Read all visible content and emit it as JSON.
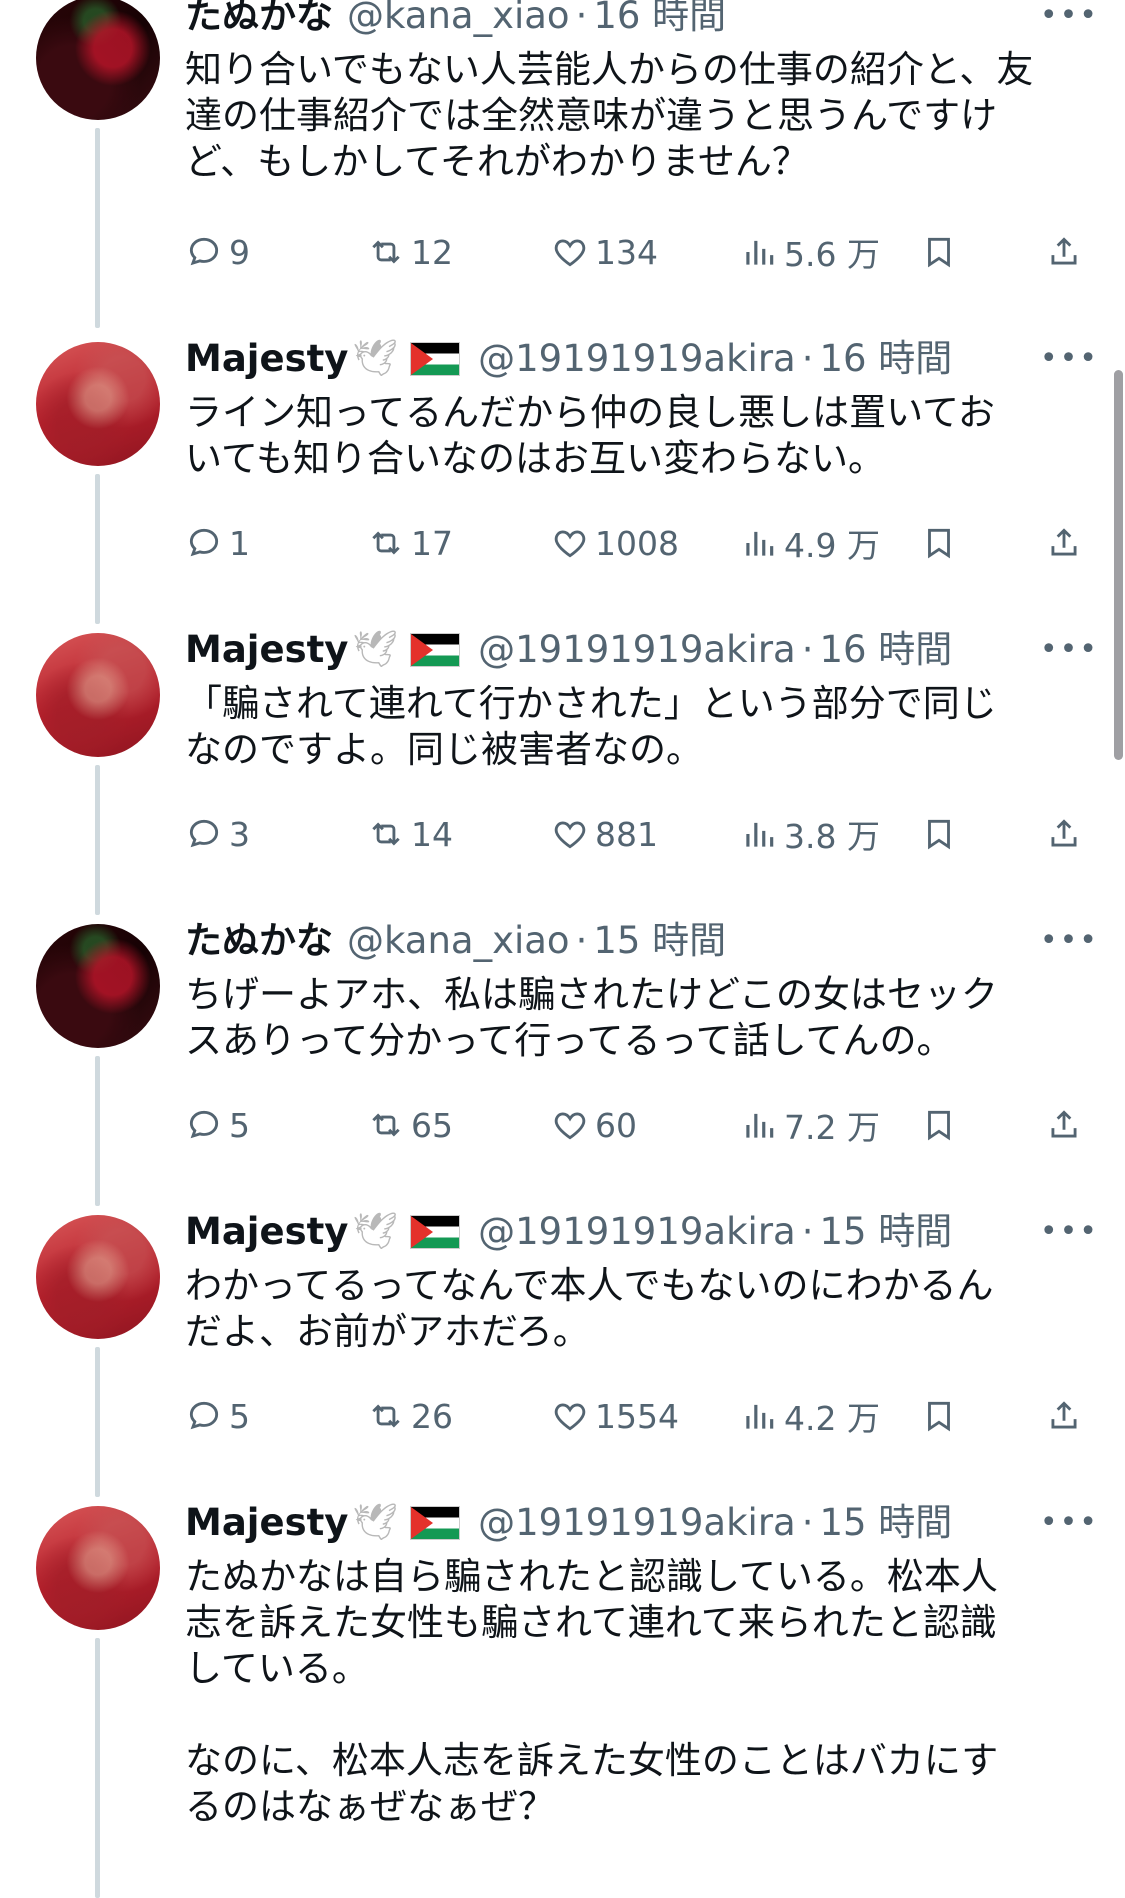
{
  "tweets": [
    {
      "author": "たぬかな",
      "avatar": "kana-avatar",
      "verified_emoji": "",
      "flag": "",
      "handle": "@kana_xiao",
      "time": "16 時間",
      "text": "知り合いでもない人芸能人からの仕事の紹介と、友\n達の仕事紹介では全然意味が違うと思うんですけ\nど、もしかしてそれがわかりません？",
      "replies": "9",
      "retweets": "12",
      "likes": "134",
      "views": "5.6 万"
    },
    {
      "author": "Majesty",
      "avatar": "majesty-avatar",
      "verified_emoji": "🕊",
      "flag": "palestine-flag",
      "handle": "@19191919akira",
      "time": "16 時間",
      "text": "ライン知ってるんだから仲の良し悪しは置いてお\nいても知り合いなのはお互い変わらない。",
      "replies": "1",
      "retweets": "17",
      "likes": "1008",
      "views": "4.9 万"
    },
    {
      "author": "Majesty",
      "avatar": "majesty-avatar",
      "verified_emoji": "🕊",
      "flag": "palestine-flag",
      "handle": "@19191919akira",
      "time": "16 時間",
      "text": "「騙されて連れて行かされた」という部分で同じ\nなのですよ。同じ被害者なの。",
      "replies": "3",
      "retweets": "14",
      "likes": "881",
      "views": "3.8 万"
    },
    {
      "author": "たぬかな",
      "avatar": "kana-avatar",
      "verified_emoji": "",
      "flag": "",
      "handle": "@kana_xiao",
      "time": "15 時間",
      "text": "ちげーよアホ、私は騙されたけどこの女はセック\nスありって分かって行ってるって話してんの。",
      "replies": "5",
      "retweets": "65",
      "likes": "60",
      "views": "7.2 万"
    },
    {
      "author": "Majesty",
      "avatar": "majesty-avatar",
      "verified_emoji": "🕊",
      "flag": "palestine-flag",
      "handle": "@19191919akira",
      "time": "15 時間",
      "text": "わかってるってなんで本人でもないのにわかるん\nだよ、お前がアホだろ。",
      "replies": "5",
      "retweets": "26",
      "likes": "1554",
      "views": "4.2 万"
    },
    {
      "author": "Majesty",
      "avatar": "majesty-avatar",
      "verified_emoji": "🕊",
      "flag": "palestine-flag",
      "handle": "@19191919akira",
      "time": "15 時間",
      "text": "たぬかなは自ら騙されたと認識している。松本人\n志を訴えた女性も騙されて連れて来られたと認識\nしている。\n\nなのに、松本人志を訴えた女性のことはバカにす\nるのはなぁぜなぁぜ？"
    }
  ],
  "ui": {
    "more_label": "•••",
    "separator": "·"
  },
  "colors": {
    "text": "#0f1419",
    "secondary": "#536471",
    "thread_line": "#cfd9de"
  }
}
